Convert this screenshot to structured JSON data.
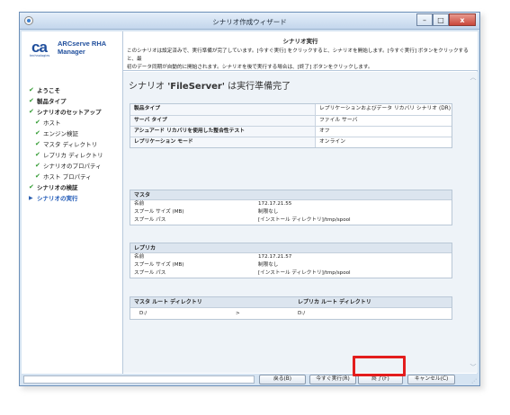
{
  "window": {
    "title": "シナリオ作成ウィザード",
    "minimize_label": "–",
    "maximize_label": "□",
    "close_label": "x"
  },
  "brand": {
    "logo_text": "ca",
    "logo_subtext": "technologies",
    "product_line1": "ARCserve RHA",
    "product_line2": "Manager"
  },
  "steps": [
    {
      "label": "ようこそ",
      "state": "done",
      "level": 0
    },
    {
      "label": "製品タイプ",
      "state": "done",
      "level": 0
    },
    {
      "label": "シナリオのセットアップ",
      "state": "done",
      "level": 0
    },
    {
      "label": "ホスト",
      "state": "done",
      "level": 1
    },
    {
      "label": "エンジン検証",
      "state": "done",
      "level": 1
    },
    {
      "label": "マスタ ディレクトリ",
      "state": "done",
      "level": 1
    },
    {
      "label": "レプリカ ディレクトリ",
      "state": "done",
      "level": 1
    },
    {
      "label": "シナリオのプロパティ",
      "state": "done",
      "level": 1
    },
    {
      "label": "ホスト プロパティ",
      "state": "done",
      "level": 1
    },
    {
      "label": "シナリオの検証",
      "state": "done",
      "level": 0
    },
    {
      "label": "シナリオの実行",
      "state": "current",
      "level": 0
    }
  ],
  "header": {
    "title": "シナリオ実行",
    "desc_line1": "このシナリオは設定済みで、実行準備が完了しています。[今すぐ実行] をクリックすると、シナリオを開始します。[今すぐ実行] ボタンをクリックすると、最",
    "desc_line2": "初のデータ同期が自動的に開始されます。シナリオを後で実行する場合は、[終了] ボタンをクリックします。"
  },
  "ready": {
    "prefix": "シナリオ ",
    "name": "'FileServer'",
    "suffix": " は実行準備完了"
  },
  "scenario_info": [
    {
      "label": "製品タイプ",
      "value": "レプリケーションおよびデータ リカバリ シナリオ (DR)"
    },
    {
      "label": "サーバ タイプ",
      "value": "ファイル サーバ"
    },
    {
      "label": "アシュアード リカバリを使用した整合性テスト",
      "value": "オフ"
    },
    {
      "label": "レプリケーション モード",
      "value": "オンライン"
    }
  ],
  "master": {
    "heading": "マスタ",
    "rows": [
      {
        "key": "名前",
        "value": "172.17.21.55"
      },
      {
        "key": "スプール サイズ (MB)",
        "value": "制限なし"
      },
      {
        "key": "スプール パス",
        "value": "[インストール ディレクトリ]/tmp/spool"
      }
    ]
  },
  "replica": {
    "heading": "レプリカ",
    "rows": [
      {
        "key": "名前",
        "value": "172.17.21.57"
      },
      {
        "key": "スプール サイズ (MB)",
        "value": "制限なし"
      },
      {
        "key": "スプール パス",
        "value": "[インストール ディレクトリ]/tmp/spool"
      }
    ]
  },
  "directories": {
    "master_header": "マスタ ルート ディレクトリ",
    "replica_header": "レプリカ ルート ディレクトリ",
    "master_dir": "D:/",
    "arrow": ">",
    "replica_dir": "D:/"
  },
  "buttons": {
    "back": "戻る(B)",
    "run_now": "今すぐ実行(R)",
    "finish": "終了(F)",
    "cancel": "キャンセル(C)"
  },
  "icons": {
    "check": "check-icon",
    "current": "arrow-right-icon",
    "scroll_up": "chevron-up-icon",
    "scroll_down": "chevron-down-icon"
  },
  "colors": {
    "highlight": "#e31d1d",
    "step_check": "#2f9a2f",
    "current_step": "#1b56b5",
    "brand": "#1f4e9c"
  }
}
